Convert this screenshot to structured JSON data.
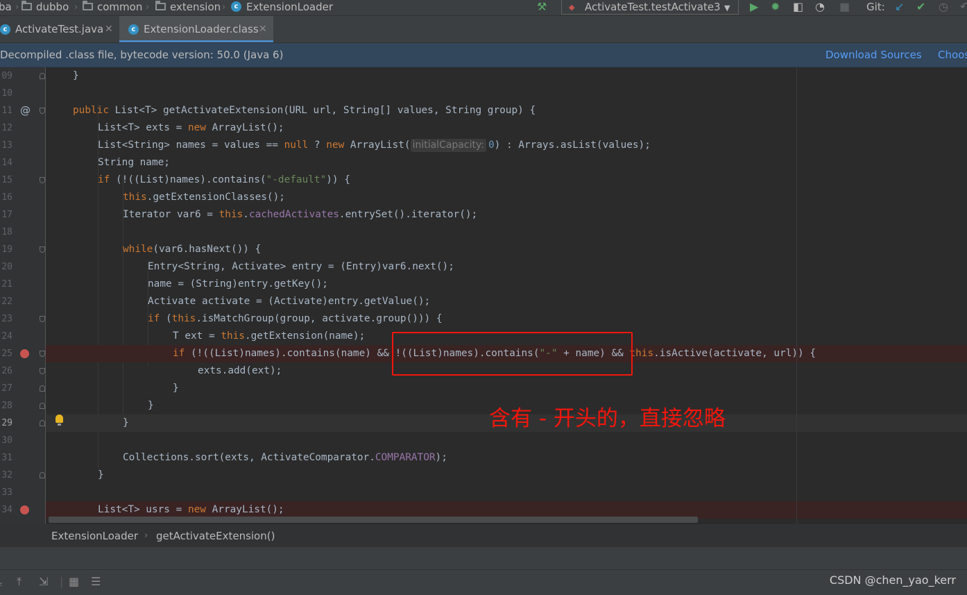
{
  "navbar": {
    "crumbs": [
      "ba",
      "dubbo",
      "common",
      "extension",
      "ExtensionLoader"
    ],
    "run_config": "ActivateTest.testActivate3",
    "git_label": "Git:"
  },
  "tabs": [
    {
      "label": "ActivateTest.java",
      "active": false
    },
    {
      "label": "ExtensionLoader.class",
      "active": true
    }
  ],
  "banner": {
    "message": "Decompiled .class file, bytecode version: 50.0 (Java 6)",
    "download_sources": "Download Sources",
    "choose_sources": "Choos"
  },
  "editor": {
    "lines": [
      {
        "num": "09",
        "indent": 3,
        "text": "}"
      },
      {
        "num": "10",
        "indent": 0,
        "text": ""
      },
      {
        "num": "11",
        "indent": 3,
        "text": "public List<T> getActivateExtension(URL url, String[] values, String group) {"
      },
      {
        "num": "12",
        "indent": 4,
        "text": "List<T> exts = new ArrayList();"
      },
      {
        "num": "13",
        "indent": 4,
        "text": "List<String> names = values == null ? new ArrayList(initialCapacity: 0) : Arrays.asList(values);"
      },
      {
        "num": "14",
        "indent": 4,
        "text": "String name;"
      },
      {
        "num": "15",
        "indent": 4,
        "text": "if (!((List)names).contains(\"-default\")) {"
      },
      {
        "num": "16",
        "indent": 5,
        "text": "this.getExtensionClasses();"
      },
      {
        "num": "17",
        "indent": 5,
        "text": "Iterator var6 = this.cachedActivates.entrySet().iterator();"
      },
      {
        "num": "18",
        "indent": 0,
        "text": ""
      },
      {
        "num": "19",
        "indent": 5,
        "text": "while(var6.hasNext()) {"
      },
      {
        "num": "20",
        "indent": 6,
        "text": "Entry<String, Activate> entry = (Entry)var6.next();"
      },
      {
        "num": "21",
        "indent": 6,
        "text": "name = (String)entry.getKey();"
      },
      {
        "num": "22",
        "indent": 6,
        "text": "Activate activate = (Activate)entry.getValue();"
      },
      {
        "num": "23",
        "indent": 6,
        "text": "if (this.isMatchGroup(group, activate.group())) {"
      },
      {
        "num": "24",
        "indent": 7,
        "text": "T ext = this.getExtension(name);"
      },
      {
        "num": "25",
        "indent": 7,
        "text": "if (!((List)names).contains(name) && !((List)names).contains(\"-\" + name) && this.isActive(activate, url)) {"
      },
      {
        "num": "26",
        "indent": 8,
        "text": "exts.add(ext);"
      },
      {
        "num": "27",
        "indent": 7,
        "text": "}"
      },
      {
        "num": "28",
        "indent": 6,
        "text": "}"
      },
      {
        "num": "29",
        "indent": 5,
        "text": "}"
      },
      {
        "num": "30",
        "indent": 0,
        "text": ""
      },
      {
        "num": "31",
        "indent": 5,
        "text": "Collections.sort(exts, ActivateComparator.COMPARATOR);"
      },
      {
        "num": "32",
        "indent": 4,
        "text": "}"
      },
      {
        "num": "33",
        "indent": 0,
        "text": ""
      },
      {
        "num": "34",
        "indent": 4,
        "text": "List<T> usrs = new ArrayList();"
      }
    ]
  },
  "annotation": {
    "text": "含有 - 开头的，直接忽略",
    "color": "#f2160c"
  },
  "breadcrumb_footer": {
    "class_name": "ExtensionLoader",
    "method_name": "getActivateExtension()"
  },
  "watermark": "CSDN @chen_yao_kerr",
  "colors": {
    "keyword": "#cc7832",
    "string": "#6a8759",
    "number": "#6897bb",
    "field": "#9876aa",
    "link": "#589df6"
  }
}
